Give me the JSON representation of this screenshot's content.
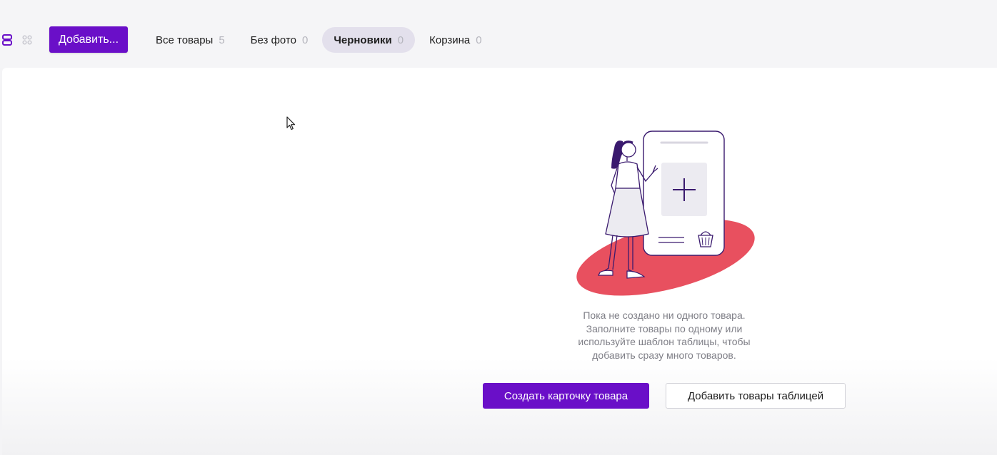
{
  "toolbar": {
    "view_toggle": [
      {
        "icon": "list-view-icon",
        "active": true
      },
      {
        "icon": "grid-view-icon",
        "active": false
      }
    ],
    "add_button_label": "Добавить...",
    "tabs": [
      {
        "label": "Все товары",
        "count": "5",
        "active": false
      },
      {
        "label": "Без фото",
        "count": "0",
        "active": false
      },
      {
        "label": "Черновики",
        "count": "0",
        "active": true
      },
      {
        "label": "Корзина",
        "count": "0",
        "active": false
      }
    ]
  },
  "empty_state": {
    "illustration_icon": "woman-with-phone-illustration",
    "message": "Пока не создано ни одного товара.\nЗаполните товары по одному или\nиспользуйте шаблон таблицы, чтобы\nдобавить сразу много товаров.",
    "primary_button_label": "Создать карточку товара",
    "secondary_button_label": "Добавить товары таблицей"
  },
  "colors": {
    "accent": "#6a0fc8",
    "active_tab_bg": "#e3e0ec",
    "illustration_blob": "#e8505f",
    "illustration_line": "#3a1a6e"
  }
}
